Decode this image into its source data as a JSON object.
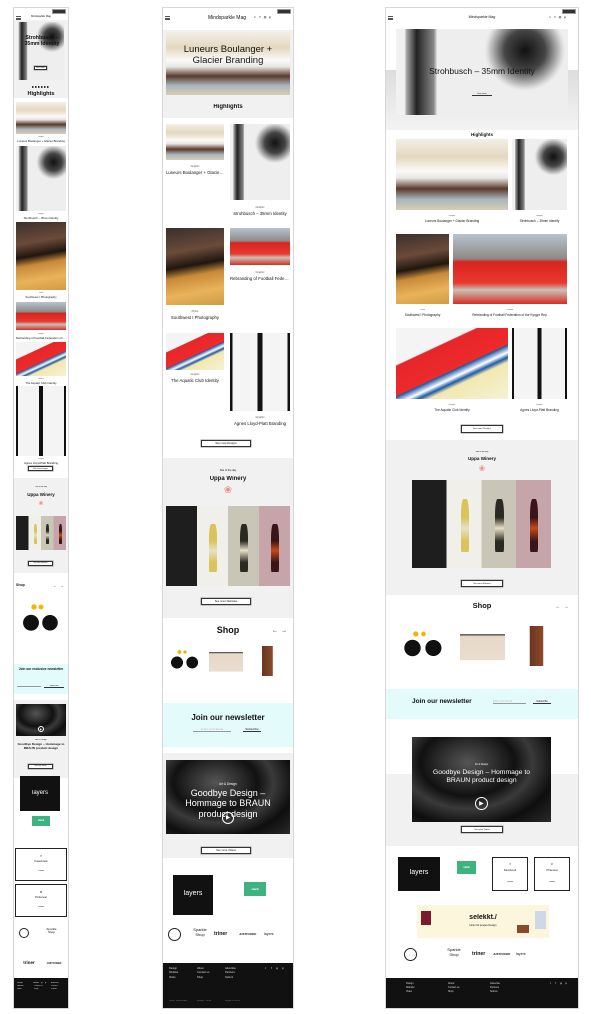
{
  "site": {
    "title": "Mindsparkle Mag",
    "social_icons": [
      "twitter-icon",
      "facebook-icon",
      "instagram-icon",
      "pinterest-icon"
    ]
  },
  "hero": {
    "mobile_title": "Strohbusch – 35mm Identity",
    "tablet_title": "Luneurs Boulanger + Glacier Branding",
    "desktop_title": "Strohbusch – 35mm Identity",
    "cta": "See more"
  },
  "highlights": {
    "title": "Highlights",
    "items": [
      {
        "category": "Graphic",
        "title": "Luneurs Boulanger + Glacier Branding"
      },
      {
        "category": "Graphic",
        "title": "Strohbusch – 35mm Identity"
      },
      {
        "category": "Photo",
        "title": "Southwest I Photography"
      },
      {
        "category": "Graphic",
        "title": "Rebranding of Football Federation of the Kyrgyz Rep."
      },
      {
        "category": "Graphic",
        "title": "The Aquatic Club Identity"
      },
      {
        "category": "Graphic",
        "title": "Agnes Lloyd-Platt Branding"
      }
    ],
    "more": "See more Designs"
  },
  "sotd": {
    "label": "Site of the day",
    "title": "Uppa Winery",
    "more": "See more Websites",
    "accent": "#f08a8a"
  },
  "shop": {
    "title": "Shop",
    "prev": "←",
    "next": "→"
  },
  "newsletter": {
    "title": "Join our newsletter",
    "mobile_title": "Join our exclusive newsletter",
    "placeholder": "Enter your Email",
    "mobile_placeholder": "Enter your Email address",
    "subscribe": "Subscribe",
    "bg": "#e3fbfb"
  },
  "video": {
    "category": "Art & Design",
    "title": "Goodbye Design – Hommage to BRAUN product design",
    "more": "See more Videos"
  },
  "partners": {
    "layers": "layers",
    "slack": "slack",
    "facebook": "Facebook",
    "pinterest": "Pinterest",
    "follow": "Follow"
  },
  "selekkt": {
    "name": "selekkt./",
    "tagline": "Heim für junges Design"
  },
  "logos": {
    "sparkle": "Sparkle Shop",
    "triner": "triner",
    "justcoded": "JUSTCODED",
    "layers": "layers"
  },
  "footer": {
    "columns": [
      [
        "Design",
        "Website",
        "Video"
      ],
      [
        "About",
        "Contact us",
        "Shop"
      ],
      [
        "Advertise",
        "Partners",
        "Submit"
      ]
    ],
    "credits": [
      "Code: JustCoded",
      "Design: Triner",
      "Legal & Terms"
    ]
  }
}
